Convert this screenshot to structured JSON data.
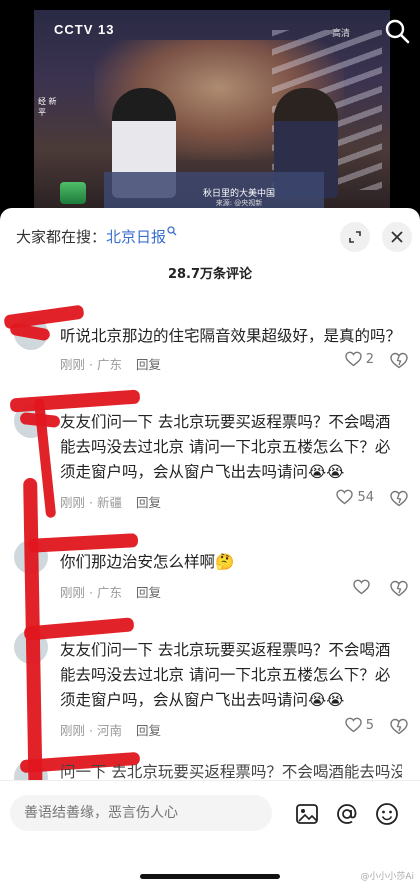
{
  "video": {
    "channel_logo": "CCTV 13",
    "hd_label": "高清",
    "side_tag": "经 新 平",
    "caption": "秋日里的大美中国",
    "source": "来源: @央视新"
  },
  "sheet": {
    "search_prefix": "大家都在搜：",
    "search_keyword": "北京日报",
    "comment_count": "28.7万条评论"
  },
  "comments": [
    {
      "text": "听说北京那边的住宅隔音效果超级好，是真的吗？",
      "time": "刚刚",
      "location": "广东",
      "reply_label": "回复",
      "likes": "2"
    },
    {
      "text": "友友们问一下 去北京玩要买返程票吗？不会喝酒能去吗没去过北京  请问一下北京五楼怎么下？必须走窗户吗，会从窗户飞出去吗请问😭😭",
      "time": "刚刚",
      "location": "新疆",
      "reply_label": "回复",
      "likes": "54"
    },
    {
      "text": "你们那边治安怎么样啊🤔",
      "time": "刚刚",
      "location": "广东",
      "reply_label": "回复",
      "likes": ""
    },
    {
      "text": "友友们问一下 去北京玩要买返程票吗？不会喝酒能去吗没去过北京  请问一下北京五楼怎么下？必须走窗户吗，会从窗户飞出去吗请问😭😭",
      "time": "刚刚",
      "location": "河南",
      "reply_label": "回复",
      "likes": "5"
    },
    {
      "text": "问一下 去北京玩要买返程票吗？不会喝酒能去吗没",
      "time": "",
      "location": "",
      "reply_label": "",
      "likes": ""
    }
  ],
  "input": {
    "placeholder": "善语结善缘，恶言伤人心"
  },
  "watermark": "@小小小莎Ai",
  "colors": {
    "accent": "#3a6fd0",
    "redaction": "#e0161e"
  },
  "icons": [
    "search-icon",
    "expand-icon",
    "close-icon",
    "heart-icon",
    "dislike-icon",
    "image-icon",
    "at-icon",
    "emoji-icon"
  ]
}
